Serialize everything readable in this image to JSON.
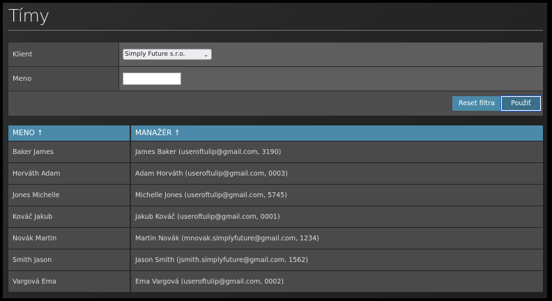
{
  "page": {
    "title": "Tímy"
  },
  "filter": {
    "client_label": "Klient",
    "client_value": "Simply Future s.r.o.",
    "name_label": "Meno",
    "name_value": "",
    "reset_label": "Reset filtra",
    "apply_label": "Použiť"
  },
  "table": {
    "headers": [
      "MENO ↑",
      "MANAŽÉR ↑"
    ],
    "rows": [
      [
        "Baker James",
        "James Baker (useroftulip@gmail.com, 3190)"
      ],
      [
        "Horváth Adam",
        "Adam Horváth (useroftulip@gmail.com, 0003)"
      ],
      [
        "Jones Michelle",
        "Michelle Jones (useroftulip@gmail.com, 5745)"
      ],
      [
        "Kováč Jakub",
        "Jakub Kováč (useroftulip@gmail.com, 0001)"
      ],
      [
        "Novák Martin",
        "Martin Novák (mnovak.simplyfuture@gmail.com, 1234)"
      ],
      [
        "Smith Jason",
        "Jason Smith (jsmith.simplyfuture@gmail.com, 1562)"
      ],
      [
        "Vargová Ema",
        "Ema Vargová (useroftulip@gmail.com, 0002)"
      ]
    ]
  }
}
